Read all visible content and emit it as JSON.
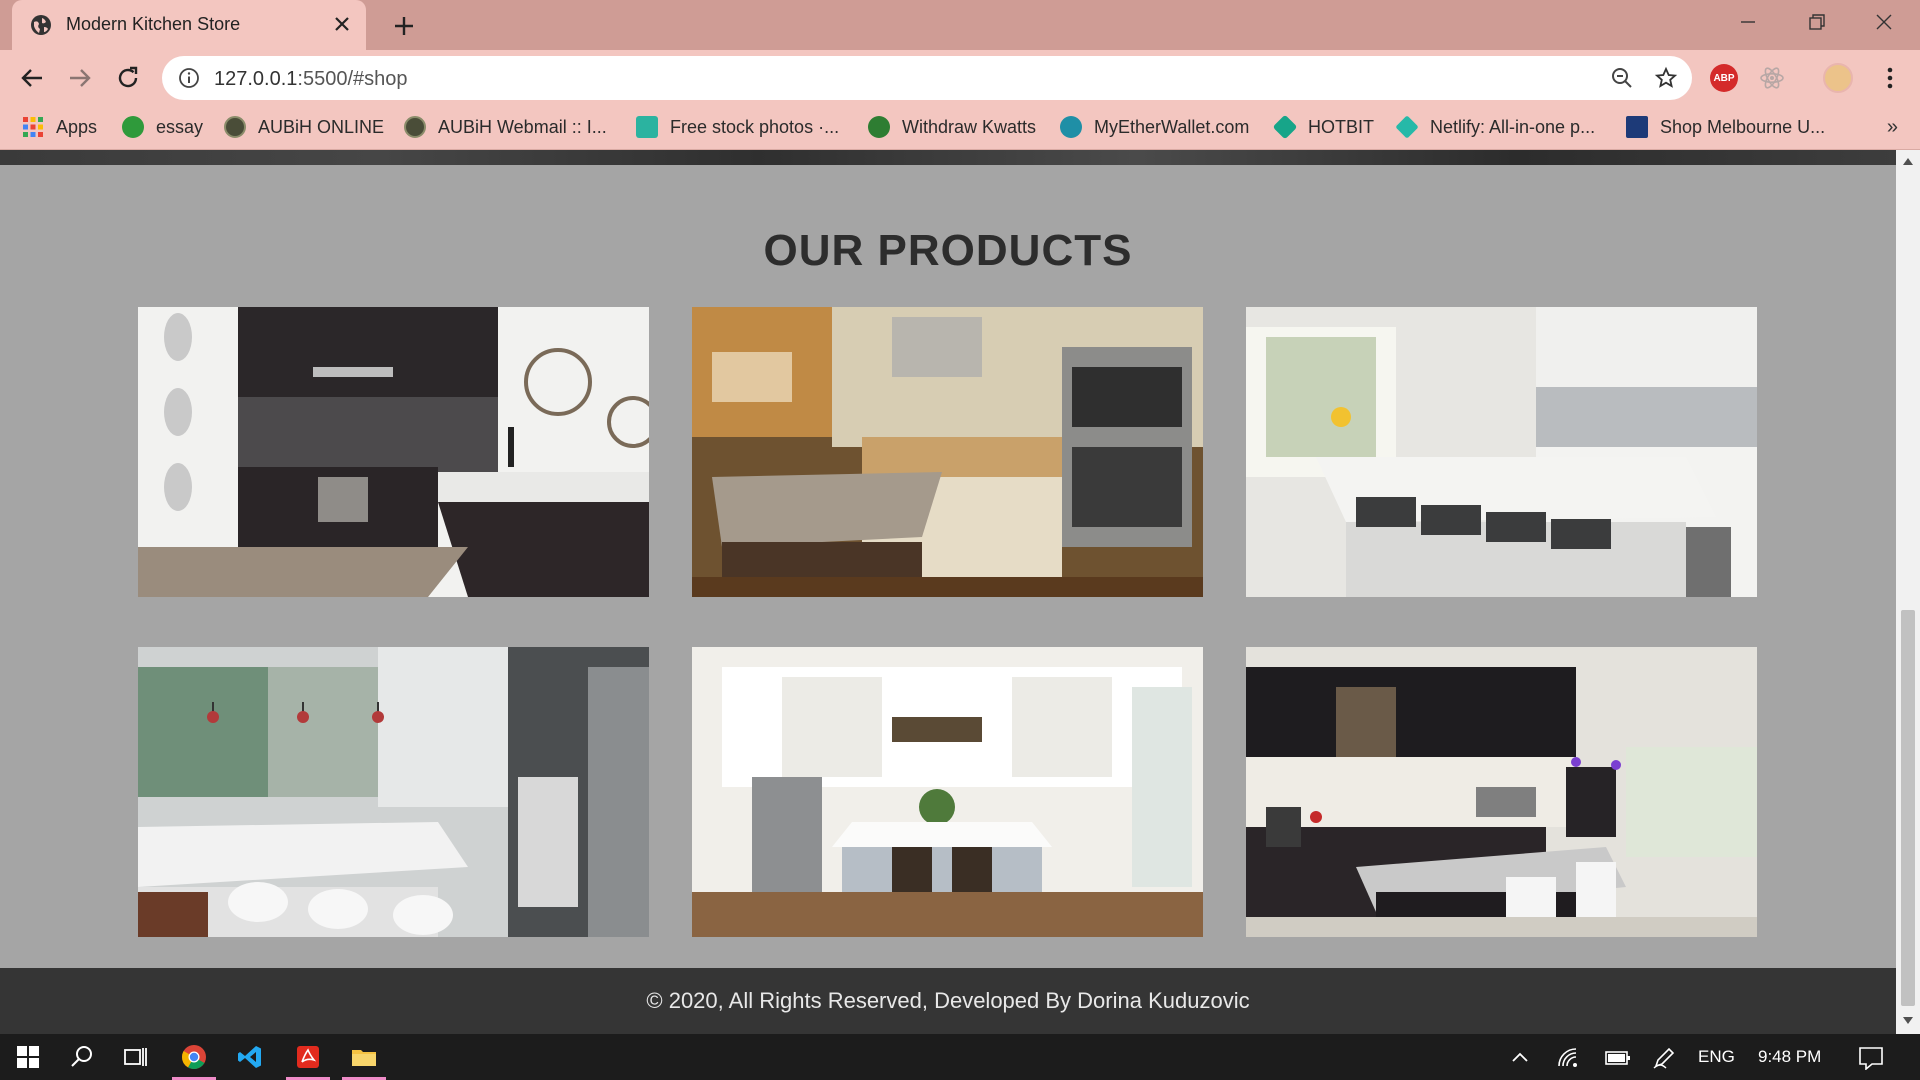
{
  "browser": {
    "tab_title": "Modern Kitchen Store",
    "url_host": "127.0.0.1",
    "url_path": ":5500/#shop",
    "bookmarks": [
      {
        "label": "Apps",
        "icon": "apps-grid-icon"
      },
      {
        "label": "essay",
        "icon": "essay-favicon"
      },
      {
        "label": "AUBiH ONLINE",
        "icon": "aubih-favicon"
      },
      {
        "label": "AUBiH Webmail :: I...",
        "icon": "aubih-webmail-favicon"
      },
      {
        "label": "Free stock photos ·...",
        "icon": "pexels-favicon"
      },
      {
        "label": "Withdraw Kwatts",
        "icon": "kwatts-favicon"
      },
      {
        "label": "MyEtherWallet.com",
        "icon": "myetherwallet-favicon"
      },
      {
        "label": "HOTBIT",
        "icon": "hotbit-favicon"
      },
      {
        "label": "Netlify: All-in-one p...",
        "icon": "netlify-favicon"
      },
      {
        "label": "Shop Melbourne U...",
        "icon": "melbourne-favicon"
      }
    ],
    "bookmarks_overflow": "»",
    "abp_label": "ABP"
  },
  "page": {
    "section_title": "OUR PRODUCTS",
    "footer_text": "© 2020, All Rights Reserved, Developed By Dorina Kuduzovic"
  },
  "taskbar": {
    "language": "ENG",
    "time": "9:48 PM"
  },
  "colors": {
    "page_bg": "#a5a5a5",
    "footer_bg": "#353535",
    "tab_active": "#f3c6c0",
    "tabbar": "#cf9c95"
  }
}
